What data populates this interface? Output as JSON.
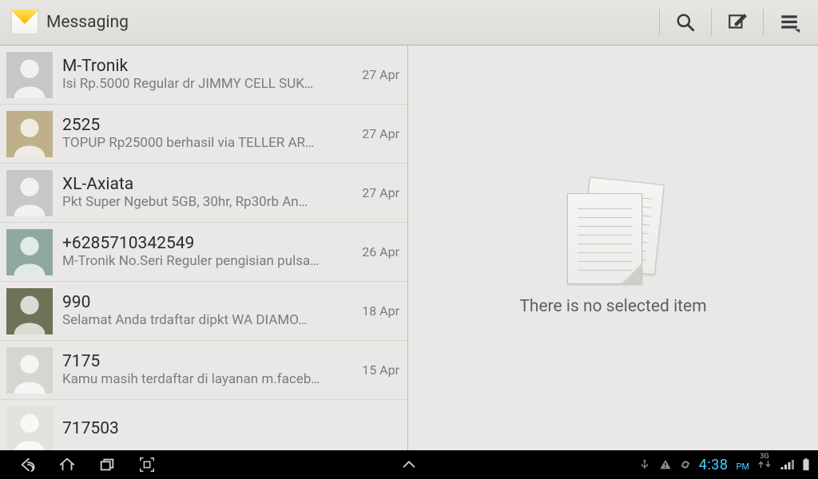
{
  "app": {
    "title": "Messaging"
  },
  "actions": {
    "search": "search",
    "compose": "compose",
    "menu": "menu"
  },
  "empty": {
    "message": "There is no selected item"
  },
  "avatar_colors": {
    "gray": "#c7c7c7",
    "tan": "#beb08a",
    "teal": "#8fa9a1",
    "olive": "#6f7257",
    "light": "#d7d5cf",
    "pale": "#e3e1dc"
  },
  "conversations": [
    {
      "name": "M-Tronik",
      "snippet": "Isi Rp.5000 Regular dr JIMMY CELL SUK…",
      "date": "27 Apr",
      "avatar": "gray"
    },
    {
      "name": "2525",
      "snippet": "TOPUP Rp25000 berhasil via TELLER AR…",
      "date": "27 Apr",
      "avatar": "tan"
    },
    {
      "name": "XL-Axiata",
      "snippet": "Pkt Super Ngebut 5GB, 30hr, Rp30rb An…",
      "date": "27 Apr",
      "avatar": "gray"
    },
    {
      "name": "+6285710342549",
      "snippet": "M-Tronik No.Seri Reguler pengisian pulsa…",
      "date": "26 Apr",
      "avatar": "teal"
    },
    {
      "name": "990",
      "snippet": "Selamat Anda trdaftar dipkt WA  DIAMO…",
      "date": "18 Apr",
      "avatar": "olive"
    },
    {
      "name": "7175",
      "snippet": "Kamu masih terdaftar di layanan m.faceb…",
      "date": "15 Apr",
      "avatar": "light"
    },
    {
      "name": "717503",
      "snippet": "",
      "date": "",
      "avatar": "pale"
    }
  ],
  "status": {
    "time": "4:38",
    "ampm": "PM",
    "network": "3G"
  }
}
